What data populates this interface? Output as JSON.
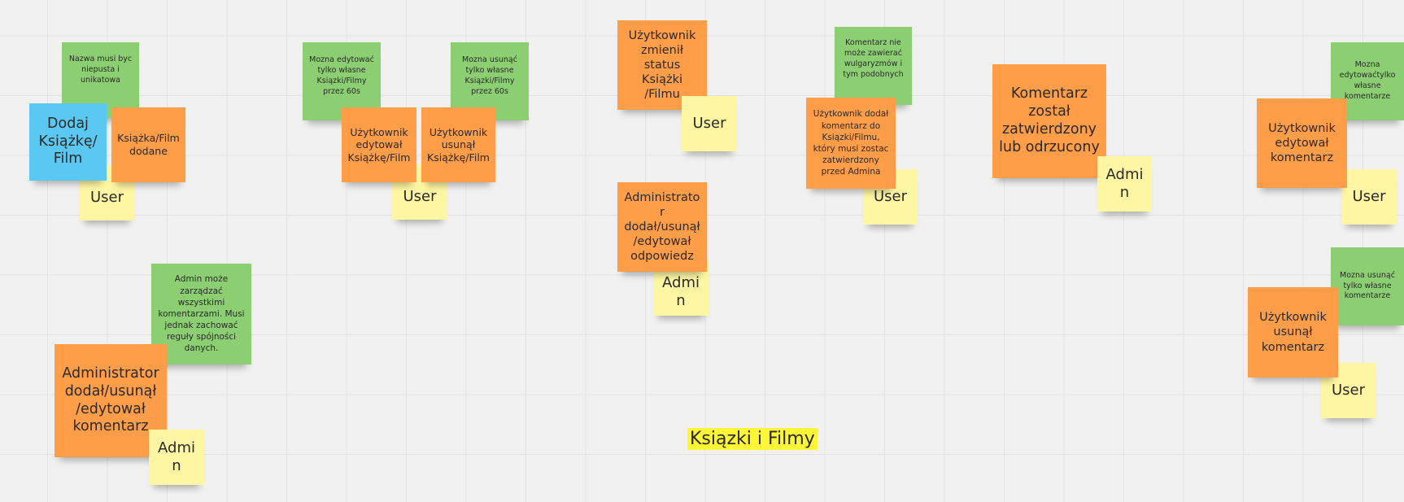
{
  "title": "Ksiązki i Filmy",
  "colors": {
    "canvas": "#f1f1f1",
    "green": "#8ccf73",
    "orange": "#ff9d48",
    "yellow": "#fff6a3",
    "blue": "#5bc8f4",
    "highlight": "#fff638"
  },
  "notes": {
    "rule_unique_name": "Nazwa musi byc niepusta i unikatowa",
    "add_item": "Dodaj Książkę/ Film",
    "item_added": "Książka/Film dodane",
    "actor_user_1": "User",
    "rule_edit_60s": "Mozna edytować tylko własne Ksiązki/Filmy przez 60s",
    "rule_delete_60s": "Mozna usunąć tylko własne Ksiązki/Filmy przez 60s",
    "item_edited": "Użytkownik edytował Książkę/Film",
    "item_deleted": "Użytkownik usunął Książkę/Film",
    "actor_user_2": "User",
    "status_changed": "Użytkownik zmienił status Książki /Filmu",
    "actor_user_3": "User",
    "admin_answer": "Administrator dodał/usunął /edytował odpowiedz",
    "actor_admin_1": "Admin",
    "rule_no_profanity": "Komentarz nie może zawierać wulgaryzmów i tym podobnych",
    "comment_added": "Użytkownik dodał komentarz do Ksiązki/Filmu, który musi zostac zatwierdzony przed Admina",
    "actor_user_4": "User",
    "comment_reviewed": "Komentarz został zatwierdzony lub odrzucony",
    "actor_admin_2": "Admin",
    "rule_edit_own_comments": "Mozna edytowaćtylko własne komentarze",
    "comment_edited": "Użytkownik edytował komentarz",
    "actor_user_5": "User",
    "rule_delete_own_comments": "Mozna usunąć tylko własne komentarze",
    "comment_deleted": "Użytkownik usunął komentarz",
    "actor_user_6": "User",
    "rule_admin_manage": "Admin może zarządzać wszystkimi komentarzami. Musi jednak zachować reguły spójności danych.",
    "admin_comment": "Administrator dodał/usunął /edytował komentarz",
    "actor_admin_3": "Admin"
  }
}
